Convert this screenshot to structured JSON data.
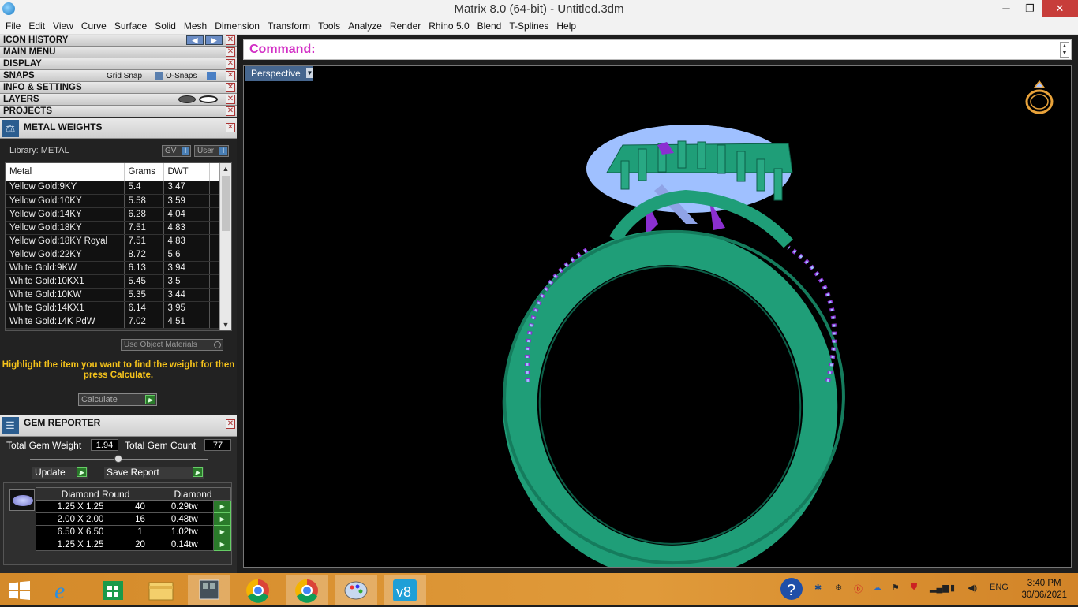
{
  "window": {
    "title": "Matrix 8.0 (64-bit) - Untitled.3dm",
    "minimize": "─",
    "restore": "❐",
    "close": "✕"
  },
  "menu": [
    "File",
    "Edit",
    "View",
    "Curve",
    "Surface",
    "Solid",
    "Mesh",
    "Dimension",
    "Transform",
    "Tools",
    "Analyze",
    "Render",
    "Rhino 5.0",
    "Blend",
    "T-Splines",
    "Help"
  ],
  "panels": {
    "icon_history": "ICON HISTORY",
    "main_menu": "MAIN MENU",
    "display": "DISPLAY",
    "snaps": "SNAPS",
    "grid_snap": "Grid Snap",
    "osnaps": "O-Snaps",
    "info_settings": "INFO & SETTINGS",
    "layers": "LAYERS",
    "projects": "PROJECTS"
  },
  "metal": {
    "title": "METAL WEIGHTS",
    "library": "Library: METAL",
    "gv": "GV",
    "user": "User",
    "columns": [
      "Metal",
      "Grams",
      "DWT"
    ],
    "rows": [
      [
        "Yellow Gold:9KY",
        "5.4",
        "3.47"
      ],
      [
        "Yellow Gold:10KY",
        "5.58",
        "3.59"
      ],
      [
        "Yellow Gold:14KY",
        "6.28",
        "4.04"
      ],
      [
        "Yellow Gold:18KY",
        "7.51",
        "4.83"
      ],
      [
        "Yellow Gold:18KY Royal",
        "7.51",
        "4.83"
      ],
      [
        "Yellow Gold:22KY",
        "8.72",
        "5.6"
      ],
      [
        "White Gold:9KW",
        "6.13",
        "3.94"
      ],
      [
        "White Gold:10KX1",
        "5.45",
        "3.5"
      ],
      [
        "White Gold:10KW",
        "5.35",
        "3.44"
      ],
      [
        "White Gold:14KX1",
        "6.14",
        "3.95"
      ],
      [
        "White Gold:14K PdW",
        "7.02",
        "4.51"
      ]
    ],
    "use_object_materials": "Use Object Materials",
    "hint": "Highlight the item you want to find the weight for then press Calculate.",
    "calculate": "Calculate"
  },
  "gem": {
    "title": "GEM REPORTER",
    "total_weight_label": "Total Gem Weight",
    "total_weight": "1.94",
    "total_count_label": "Total Gem Count",
    "total_count": "77",
    "update": "Update",
    "save_report": "Save Report",
    "col_shape": "Diamond Round",
    "col_material": "Diamond",
    "rows": [
      [
        "1.25 X 1.25",
        "40",
        "0.29tw"
      ],
      [
        "2.00 X 2.00",
        "16",
        "0.48tw"
      ],
      [
        "6.50 X 6.50",
        "1",
        "1.02tw"
      ],
      [
        "1.25 X 1.25",
        "20",
        "0.14tw"
      ]
    ]
  },
  "command": {
    "label": "Command:"
  },
  "viewport": {
    "name": "Perspective"
  },
  "tray": {
    "lang": "ENG",
    "time": "3:40 PM",
    "date": "30/06/2021"
  },
  "colors": {
    "cmd": "#d22fc5",
    "ring": "#1f9e78",
    "gem": "#8b2fd1",
    "hint": "#f4c21b"
  }
}
